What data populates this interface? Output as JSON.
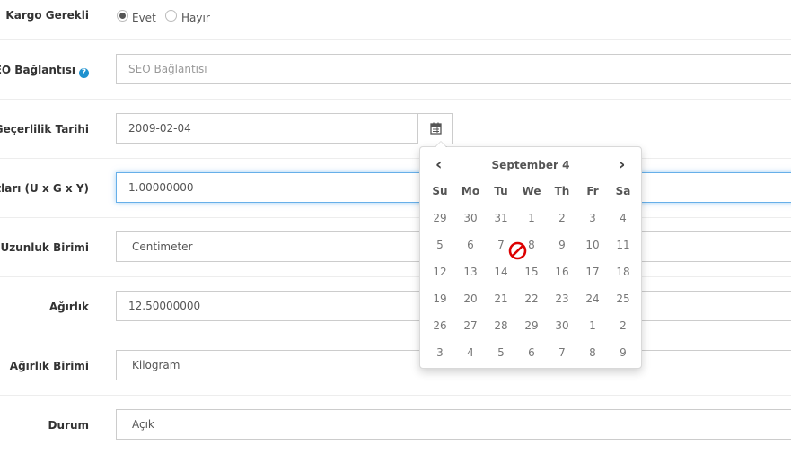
{
  "fields": {
    "shipping": {
      "label": "Kargo Gerekli",
      "yes": "Evet",
      "no": "Hayır"
    },
    "seo": {
      "label": "SEO Bağlantısı",
      "placeholder": "SEO Bağlantısı",
      "help": "?"
    },
    "valid_date": {
      "label": "Geçerlilik Tarihi",
      "value": "2009-02-04"
    },
    "dimensions": {
      "label": "yutları (U x G x Y)",
      "value": "1.00000000"
    },
    "length_unit": {
      "label": "Uzunluk Birimi",
      "value": "Centimeter"
    },
    "weight": {
      "label": "Ağırlık",
      "value": "12.50000000"
    },
    "weight_unit": {
      "label": "Ağırlık Birimi",
      "value": "Kilogram"
    },
    "status": {
      "label": "Durum",
      "value": "Açık"
    }
  },
  "datepicker": {
    "title": "September 4",
    "prev": "‹",
    "next": "›",
    "weekdays": [
      "Su",
      "Mo",
      "Tu",
      "We",
      "Th",
      "Fr",
      "Sa"
    ],
    "weeks": [
      [
        "29",
        "30",
        "31",
        "1",
        "2",
        "3",
        "4"
      ],
      [
        "5",
        "6",
        "7",
        "8",
        "9",
        "10",
        "11"
      ],
      [
        "12",
        "13",
        "14",
        "15",
        "16",
        "17",
        "18"
      ],
      [
        "19",
        "20",
        "21",
        "22",
        "23",
        "24",
        "25"
      ],
      [
        "26",
        "27",
        "28",
        "29",
        "30",
        "1",
        "2"
      ],
      [
        "3",
        "4",
        "5",
        "6",
        "7",
        "8",
        "9"
      ]
    ]
  },
  "icons": {
    "calendar": "calendar-icon",
    "cursor": "not-allowed-cursor-icon"
  }
}
